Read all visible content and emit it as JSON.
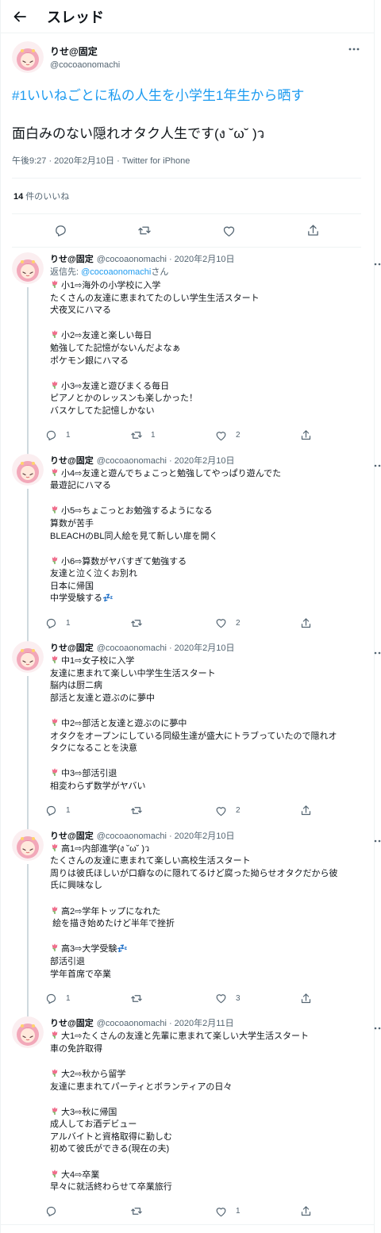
{
  "header": {
    "title": "スレッド"
  },
  "main_tweet": {
    "author_name": "りせ@固定",
    "author_handle": "@cocoaonomachi",
    "hashtag_text": "#1いいねごとに私の人生を小学生1年生から晒す",
    "body_text": "面白みのない隠れオタク人生です(ง ˘ω˘ )ว",
    "meta": "午後9:27 · 2020年2月10日 · Twitter for iPhone",
    "likes_count": "14",
    "likes_label": " 件のいいね"
  },
  "replies": [
    {
      "name": "りせ@固定",
      "handle": "@cocoaonomachi",
      "date": "2020年2月10日",
      "reply_to_prefix": "返信先: ",
      "reply_to_mention": "@cocoaonomachi",
      "reply_to_suffix": "さん",
      "lines": [
        "小1⇨海外の小学校に入学",
        "たくさんの友達に恵まれてたのしい学生生活スタート",
        "犬夜叉にハマる",
        "",
        "小2⇨友達と楽しい毎日",
        "勉強してた記憶がないんだよなぁ",
        "ポケモン銀にハマる",
        "",
        "小3⇨友達と遊びまくる毎日",
        "ピアノとかのレッスンも楽しかった！",
        "バスケしてた記憶しかない"
      ],
      "reply_count": "1",
      "retweet_count": "1",
      "like_count": "2"
    },
    {
      "name": "りせ@固定",
      "handle": "@cocoaonomachi",
      "date": "2020年2月10日",
      "lines": [
        "小4⇨友達と遊んでちょこっと勉強してやっぱり遊んでた",
        "最遊記にハマる",
        "",
        "小5⇨ちょこっとお勉強するようになる",
        "算数が苦手",
        "BLEACHのBL同人絵を見て新しい扉を開く",
        "",
        "小6⇨算数がヤバすぎて勉強する",
        "友達と泣く泣くお別れ",
        "日本に帰国",
        "中学受験する💤"
      ],
      "reply_count": "1",
      "retweet_count": "",
      "like_count": "2"
    },
    {
      "name": "りせ@固定",
      "handle": "@cocoaonomachi",
      "date": "2020年2月10日",
      "lines": [
        "中1⇨女子校に入学",
        "友達に恵まれて楽しい中学生生活スタート",
        "脳内は厨二病",
        "部活と友達と遊ぶのに夢中",
        "",
        "中2⇨部活と友達と遊ぶのに夢中",
        "オタクをオープンにしている同級生達が盛大にトラブっていたので隠れオ",
        "タクになることを決意",
        "",
        "中3⇨部活引退",
        "相変わらず数学がヤバい"
      ],
      "reply_count": "1",
      "retweet_count": "",
      "like_count": "2"
    },
    {
      "name": "りせ@固定",
      "handle": "@cocoaonomachi",
      "date": "2020年2月10日",
      "lines": [
        "高1⇨内部進学(ง ˘ω˘ )ว",
        "たくさんの友達に恵まれて楽しい高校生活スタート",
        "周りは彼氏ほしいが口癖なのに隠れてるけど腐った拗らせオタクだから彼",
        "氏に興味なし",
        "",
        "高2⇨学年トップになれた",
        " 絵を描き始めたけど半年で挫折",
        "",
        "高3⇨大学受験💤",
        "部活引退",
        "学年首席で卒業"
      ],
      "reply_count": "1",
      "retweet_count": "",
      "like_count": "3"
    },
    {
      "name": "りせ@固定",
      "handle": "@cocoaonomachi",
      "date": "2020年2月11日",
      "lines": [
        "大1⇨たくさんの友達と先輩に恵まれて楽しい大学生活スタート",
        "車の免許取得",
        "",
        "大2⇨秋から留学",
        "友達に恵まれてパーティとボランティアの日々",
        "",
        "大3⇨秋に帰国",
        "成人してお酒デビュー",
        "アルバイトと資格取得に勤しむ",
        "初めて彼氏ができる(現在の夫)",
        "",
        "大4⇨卒業",
        "早々に就活終わらせて卒業旅行"
      ],
      "reply_count": "",
      "retweet_count": "",
      "like_count": "1"
    }
  ],
  "colors": {
    "accent": "#1d9bf0",
    "secondary_text": "#536471",
    "border": "#eff3f4",
    "thread_line": "#cfd9de",
    "tulip_pink": "#f06e8c",
    "tulip_green": "#5fa849"
  }
}
